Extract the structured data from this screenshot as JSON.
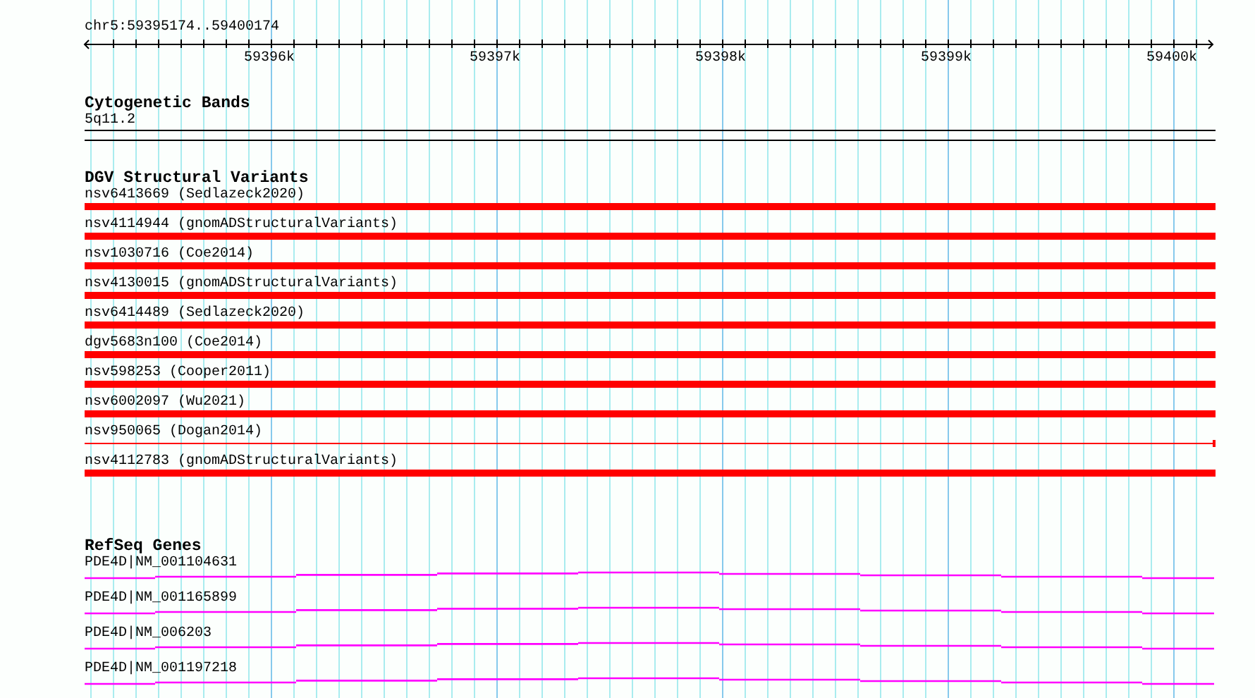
{
  "ruler": {
    "location": "chr5:59395174..59400174",
    "ticks": [
      "59396k",
      "59397k",
      "59398k",
      "59399k",
      "59400k"
    ]
  },
  "tracks": [
    {
      "kind": "bands",
      "title": "Cytogenetic Bands",
      "features": [
        {
          "label": "5q11.2"
        }
      ]
    },
    {
      "kind": "variants",
      "title": "DGV Structural Variants",
      "features": [
        {
          "label": "nsv6413669 (Sedlazeck2020)",
          "kind": "bar"
        },
        {
          "label": "nsv4114944 (gnomADStructuralVariants)",
          "kind": "bar"
        },
        {
          "label": "nsv1030716 (Coe2014)",
          "kind": "bar"
        },
        {
          "label": "nsv4130015 (gnomADStructuralVariants)",
          "kind": "bar"
        },
        {
          "label": "nsv6414489 (Sedlazeck2020)",
          "kind": "bar"
        },
        {
          "label": "dgv5683n100 (Coe2014)",
          "kind": "bar"
        },
        {
          "label": "nsv598253 (Cooper2011)",
          "kind": "bar"
        },
        {
          "label": "nsv6002097 (Wu2021)",
          "kind": "bar"
        },
        {
          "label": "nsv950065 (Dogan2014)",
          "kind": "line"
        },
        {
          "label": "nsv4112783 (gnomADStructuralVariants)",
          "kind": "bar"
        }
      ]
    },
    {
      "kind": "genes",
      "title": "RefSeq Genes",
      "features": [
        {
          "label": "PDE4D|NM_001104631"
        },
        {
          "label": "PDE4D|NM_001165899"
        },
        {
          "label": "PDE4D|NM_006203"
        },
        {
          "label": "PDE4D|NM_001197218"
        }
      ]
    }
  ]
}
